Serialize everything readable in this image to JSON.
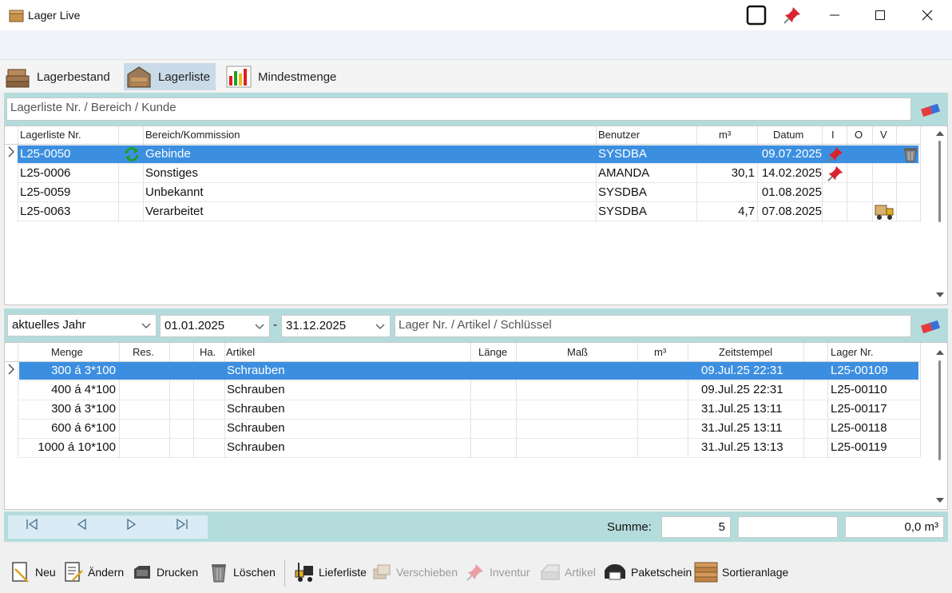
{
  "window": {
    "title": "Lager Live"
  },
  "tabs": [
    {
      "label": "Lagerbestand",
      "active": false
    },
    {
      "label": "Lagerliste",
      "active": true
    },
    {
      "label": "Mindestmenge",
      "active": false
    }
  ],
  "top_search": {
    "placeholder": "Lagerliste Nr.  / Bereich / Kunde"
  },
  "lists_table": {
    "headers": [
      "Lagerliste Nr.",
      "Bereich/Kommission",
      "Benutzer",
      "m³",
      "Datum",
      "I",
      "O",
      "V"
    ],
    "rows": [
      {
        "nr": "L25-0050",
        "bereich": "Gebinde",
        "benutzer": "SYSDBA",
        "m3": "",
        "datum": "09.07.2025",
        "i_icon": "pin-icon",
        "extra_icon": "trash-icon",
        "refresh": true,
        "selected": true
      },
      {
        "nr": "L25-0006",
        "bereich": "Sonstiges",
        "benutzer": "AMANDA",
        "m3": "30,1",
        "datum": "14.02.2025",
        "i_icon": "pin-icon"
      },
      {
        "nr": "L25-0059",
        "bereich": "Unbekannt",
        "benutzer": "SYSDBA",
        "m3": "",
        "datum": "01.08.2025"
      },
      {
        "nr": "L25-0063",
        "bereich": "Verarbeitet",
        "benutzer": "SYSDBA",
        "m3": "4,7",
        "datum": "07.08.2025",
        "v_icon": "forklift-icon"
      }
    ]
  },
  "filters": {
    "period": "aktuelles Jahr",
    "date_from": "01.01.2025",
    "date_sep": "-",
    "date_to": "31.12.2025",
    "search_placeholder": "Lager Nr.  / Artikel / Schlüssel"
  },
  "items_table": {
    "headers": [
      "Menge",
      "Res.",
      "Ha.",
      "Artikel",
      "Länge",
      "Maß",
      "m³",
      "Zeitstempel",
      "Lager Nr."
    ],
    "rows": [
      {
        "menge": "300 á 3*100",
        "artikel": "Schrauben",
        "zeit": "09.Jul.25 22:31",
        "lager": "L25-00109",
        "selected": true
      },
      {
        "menge": "400 á 4*100",
        "artikel": "Schrauben",
        "zeit": "09.Jul.25 22:31",
        "lager": "L25-00110"
      },
      {
        "menge": "300 á 3*100",
        "artikel": "Schrauben",
        "zeit": "31.Jul.25 13:11",
        "lager": "L25-00117"
      },
      {
        "menge": "600 á 6*100",
        "artikel": "Schrauben",
        "zeit": "31.Jul.25 13:11",
        "lager": "L25-00118"
      },
      {
        "menge": "1000 á 10*100",
        "artikel": "Schrauben",
        "zeit": "31.Jul.25 13:13",
        "lager": "L25-00119"
      }
    ]
  },
  "summary": {
    "label": "Summe:",
    "count": "5",
    "middle": "",
    "volume": "0,0 m³"
  },
  "toolbar": [
    {
      "label": "Neu",
      "icon": "new-document-icon",
      "enabled": true
    },
    {
      "label": "Ändern",
      "icon": "edit-document-icon",
      "enabled": true
    },
    {
      "label": "Drucken",
      "icon": "printer-icon",
      "enabled": true
    },
    {
      "label": "Löschen",
      "icon": "trash-icon",
      "enabled": true
    },
    {
      "label": "Lieferliste",
      "icon": "forklift-icon",
      "enabled": true
    },
    {
      "label": "Verschieben",
      "icon": "move-icon",
      "enabled": false
    },
    {
      "label": "Inventur",
      "icon": "pin-icon",
      "enabled": false
    },
    {
      "label": "Artikel",
      "icon": "lumber-icon",
      "enabled": false
    },
    {
      "label": "Paketschein",
      "icon": "label-printer-icon",
      "enabled": true
    },
    {
      "label": "Sortieranlage",
      "icon": "wood-stack-icon",
      "enabled": true
    }
  ]
}
